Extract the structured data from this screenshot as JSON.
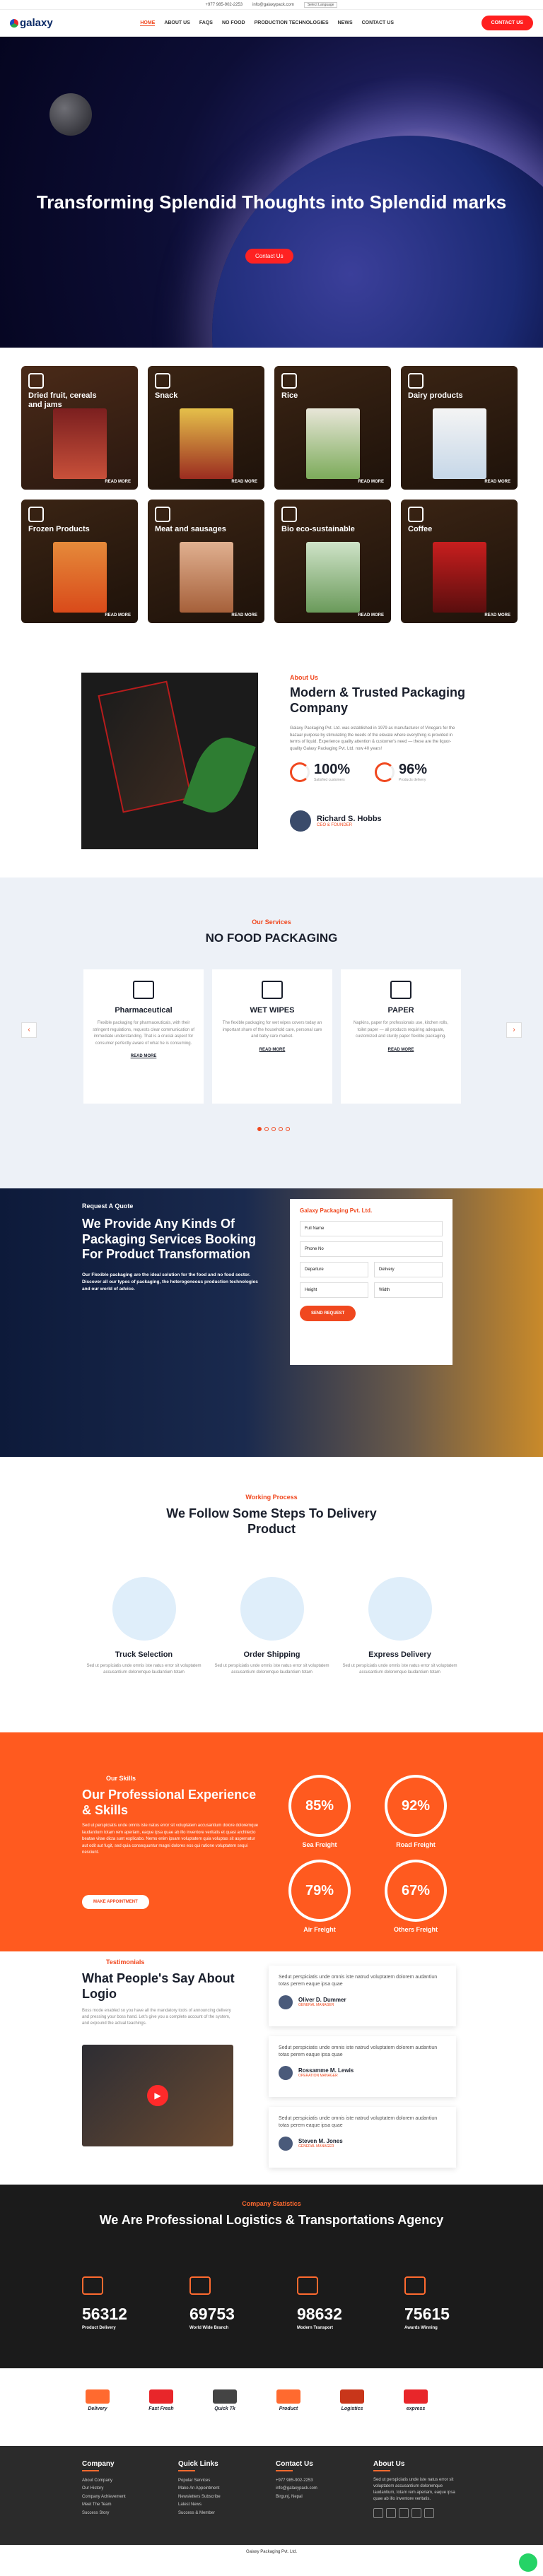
{
  "topbar": {
    "phone": "+977 985-902-2253",
    "email": "info@galaxypack.com",
    "language": "Select Language"
  },
  "brand": {
    "name": "galaxy"
  },
  "nav": {
    "items": [
      "HOME",
      "ABOUT US",
      "FAQS",
      "NO FOOD",
      "PRODUCTION TECHNOLOGIES",
      "NEWS",
      "CONTACT US"
    ],
    "contact_btn": "CONTACT US"
  },
  "hero": {
    "title": "Transforming Splendid Thoughts into Splendid marks",
    "button": "Contact Us"
  },
  "categories": {
    "read_more": "READ MORE",
    "items": [
      {
        "title": "Dried fruit, cereals and jams"
      },
      {
        "title": "Snack"
      },
      {
        "title": "Rice"
      },
      {
        "title": "Dairy products"
      },
      {
        "title": "Frozen Products"
      },
      {
        "title": "Meat and sausages"
      },
      {
        "title": "Bio eco-sustainable"
      },
      {
        "title": "Coffee"
      }
    ]
  },
  "about": {
    "kicker": "About Us",
    "title": "Modern & Trusted Packaging Company",
    "text": "Galaxy Packaging Pvt. Ltd. was established in 1979 as manufacturer of Vinegars for the bazaar purpose by stimulating the needs of the elevate where everything is provided in terms of liquid. Experience quality attention & customer's need — these are the liquor-quality Galaxy Packaging Pvt. Ltd. now 40 years!",
    "stats": [
      {
        "value": "100%",
        "label": "Satisfied customers"
      },
      {
        "value": "96%",
        "label": "Products delivery"
      }
    ],
    "person": {
      "name": "Richard S. Hobbs",
      "role": "CEO & FOUNDER"
    }
  },
  "services": {
    "kicker": "Our Services",
    "title": "NO FOOD PACKAGING",
    "items": [
      {
        "title": "Pharmaceutical",
        "text": "Flexible packaging for pharmaceuticals, with their stringent regulations, requests clear communication of immediate understanding. That is a crucial aspect for consumer perfectly aware of what he is consuming.",
        "more": "READ MORE"
      },
      {
        "title": "WET WIPES",
        "text": "The flexible packaging for wet wipes covers today an important share of the household care, personal care and baby care market.",
        "more": "READ MORE"
      },
      {
        "title": "PAPER",
        "text": "Napkins, paper for professionals use, kitchen rolls, toilet paper — all products requiring adequate, customized and sturdy paper flexible packaging.",
        "more": "READ MORE"
      }
    ],
    "prev": "‹",
    "next": "›"
  },
  "quote": {
    "kicker": "Request A Quote",
    "title": "We Provide Any Kinds Of Packaging Services Booking For Product Transformation",
    "text": "Our Flexible packaging are the ideal solution for the food and no food sector. Discover all our types of packaging, the heterogeneous production technologies and our world of advice.",
    "form": {
      "heading": "Galaxy Packaging Pvt. Ltd.",
      "full_name": "Full Name",
      "phone": "Phone No",
      "departure": "Departure",
      "delivery": "Delivery",
      "height": "Height",
      "width": "Width",
      "submit": "SEND REQUEST"
    }
  },
  "process": {
    "kicker": "Working Process",
    "title": "We Follow Some Steps To Delivery Product",
    "steps": [
      {
        "title": "Truck Selection",
        "text": "Sed ut perspiciatis unde omnis iste natus error sit voluptatem accusantium doloremque laudantium totam"
      },
      {
        "title": "Order Shipping",
        "text": "Sed ut perspiciatis unde omnis iste natus error sit voluptatem accusantium doloremque laudantium totam"
      },
      {
        "title": "Express Delivery",
        "text": "Sed ut perspiciatis unde omnis iste natus error sit voluptatem accusantium doloremque laudantium totam"
      }
    ]
  },
  "skills": {
    "kicker": "Our Skills",
    "title": "Our Professional Experience & Skills",
    "text": "Sed ut perspiciatis unde omnis iste natus error sit voluptatem accusantium dolore doloremque laudantium totam rem aperiam, eaque ipsa quae ab illo inventore veritatis et quasi architecto beatae vitae dicta sunt explicabo. Nemo enim ipsam voluptatem quia voluptas sit aspernatur aut odit aut fugit, sed quia consequuntur magni dolores eos qui ratione voluptatem sequi nesciunt.",
    "button": "MAKE APPOINTMENT",
    "items": [
      {
        "value": "85%",
        "label": "Sea Freight"
      },
      {
        "value": "92%",
        "label": "Road Freight"
      },
      {
        "value": "79%",
        "label": "Air Freight"
      },
      {
        "value": "67%",
        "label": "Others Freight"
      }
    ]
  },
  "testimonials": {
    "kicker": "Testimonials",
    "title": "What People's Say About Logio",
    "text": "Boss mode enabled so you have all the mandatory tools of announcing delivery and pressing your boss hand. Let's give you a complete account of the system, and expound the actual teachings.",
    "items": [
      {
        "quote": "Sedut perspiciatis unde omnis iste natrud voluptatem dolorem audantiun totas perem eaque ipsa quae",
        "name": "Oliver D. Dummer",
        "role": "GENERAL MANAGER"
      },
      {
        "quote": "Sedut perspiciatis unde omnis iste natrud voluptatem dolorem audantiun totas perem eaque ipsa quae",
        "name": "Rossamme M. Lewis",
        "role": "OPERATION MANAGER"
      },
      {
        "quote": "Sedut perspiciatis unde omnis iste natrud voluptatem dolorem audantiun totas perem eaque ipsa quae",
        "name": "Steven M. Jones",
        "role": "GENERAL MANAGER"
      }
    ]
  },
  "statistics": {
    "kicker": "Company Statistics",
    "title": "We Are Professional Logistics & Transportations Agency",
    "items": [
      {
        "value": "56312",
        "label": "Product Delivery"
      },
      {
        "value": "69753",
        "label": "World Wide Branch"
      },
      {
        "value": "98632",
        "label": "Modern Transport"
      },
      {
        "value": "75615",
        "label": "Awards Winning"
      }
    ]
  },
  "brands": [
    "Delivery",
    "Fast Fresh",
    "Quick Tk",
    "Product",
    "Logistics",
    "express"
  ],
  "footer": {
    "company": {
      "heading": "Company",
      "items": [
        "About Company",
        "Our History",
        "Company Achievement",
        "Meet The Team",
        "Success Story"
      ]
    },
    "links": {
      "heading": "Quick Links",
      "items": [
        "Popular Services",
        "Make An Appointment",
        "Newsletters Subscribe",
        "Latest News",
        "Success & Member"
      ]
    },
    "contact": {
      "heading": "Contact Us",
      "items": [
        "+977 985-902-2253",
        "info@galaxypack.com",
        "Birgunj, Nepal"
      ]
    },
    "about": {
      "heading": "About Us",
      "text": "Sed ut perspiciatis unde iste natus error sit voluptatem accusantium doloremque laudantium, totam rem aperiam, eaque ipsa quae ab illo inventore veritatis."
    },
    "copyright": "Galaxy Packaging Pvt. Ltd."
  }
}
